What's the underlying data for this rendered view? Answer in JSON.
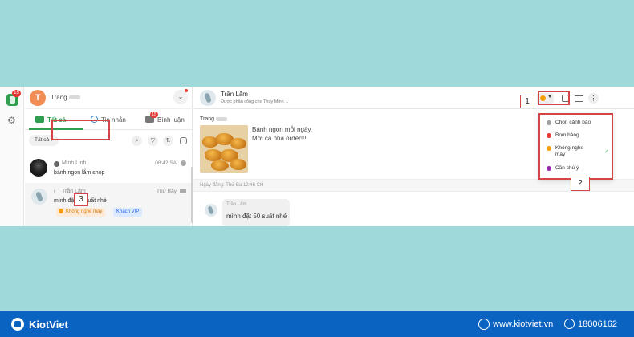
{
  "left_panel": {
    "user_initial": "T",
    "user_name": "Trang",
    "tabs": [
      {
        "label": "Tất cả"
      },
      {
        "label": "Tin nhắn"
      },
      {
        "label": "Bình luận",
        "badge": "15"
      }
    ],
    "filter_label": "Tất cả",
    "conversations": [
      {
        "name": "Minh Linh",
        "time": "08:42 SA",
        "message": "bánh ngon lắm shop"
      },
      {
        "name": "Trần Lâm",
        "time": "Thứ Bảy",
        "message": "mình đặt 50 suất nhé",
        "tags": [
          "Không nghe máy",
          "Khách VIP"
        ]
      }
    ]
  },
  "rail": {
    "badge": "15"
  },
  "chat": {
    "name": "Trần Lâm",
    "assigned": "Được phân công cho Thủy Minh",
    "sender": "Trang",
    "post_text_1": "Bánh ngon mỗi ngày.",
    "post_text_2": "Mời cả nhà order!!!",
    "posted_date": "Ngày đăng: Thứ Ba 12:46 CH",
    "reply_name": "Trần Lâm",
    "reply_text": "mình đặt 50 suất nhé"
  },
  "warning_menu": {
    "items": [
      {
        "label": "Chọn cảnh báo",
        "color": "#9e9e9e"
      },
      {
        "label": "Bom hàng",
        "color": "#e53935"
      },
      {
        "label": "Không nghe máy",
        "color": "#f59e0b",
        "selected": true
      },
      {
        "label": "Cần chú ý",
        "color": "#9c27b0"
      }
    ]
  },
  "annotations": {
    "one": "1",
    "two": "2",
    "three": "3"
  },
  "footer": {
    "brand": "KiotViet",
    "website": "www.kiotviet.vn",
    "phone": "18006162"
  },
  "colors": {
    "accent": "#2f9e4f",
    "footer": "#0b63c1",
    "highlight": "#d64545"
  }
}
